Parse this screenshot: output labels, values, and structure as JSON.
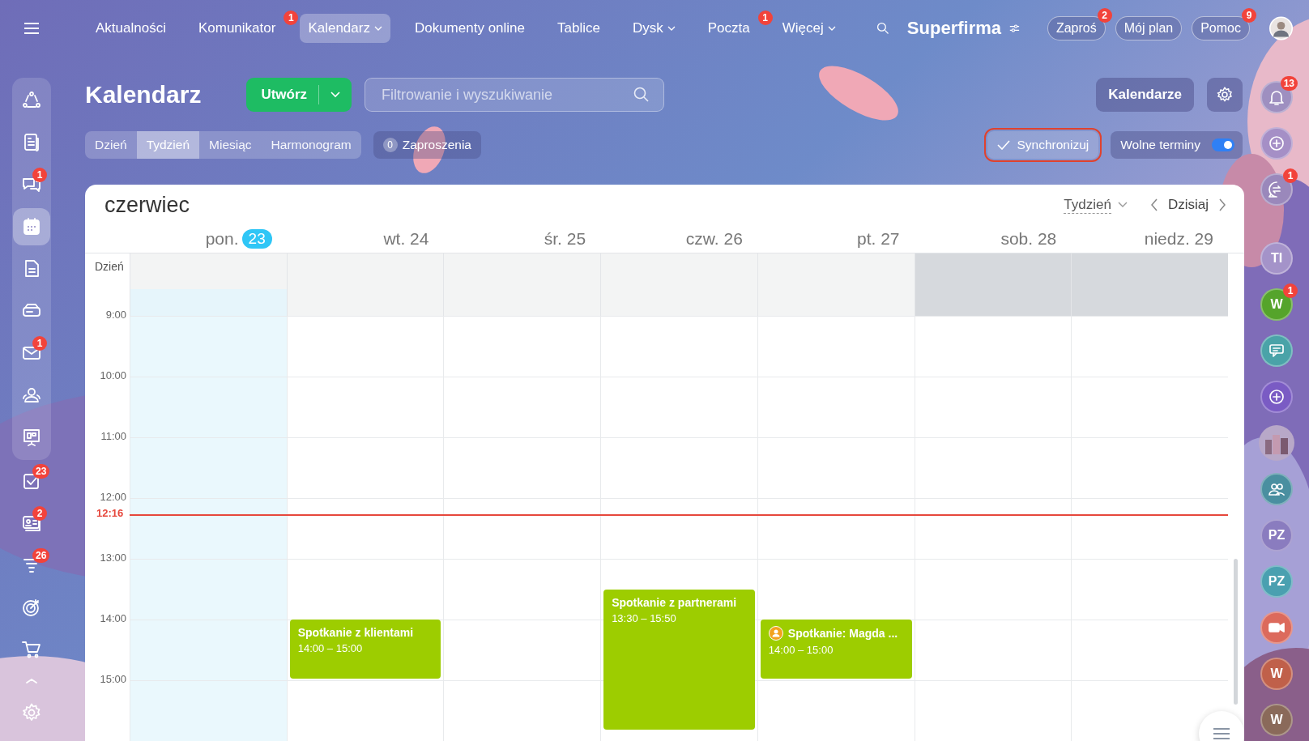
{
  "topbar": {
    "nav": [
      {
        "label": "Aktualności",
        "selected": false,
        "dropdown": false
      },
      {
        "label": "Komunikator",
        "selected": false,
        "dropdown": false,
        "badge": "1"
      },
      {
        "label": "Kalendarz",
        "selected": true,
        "dropdown": true
      },
      {
        "label": "Dokumenty online",
        "selected": false,
        "dropdown": false
      },
      {
        "label": "Tablice",
        "selected": false,
        "dropdown": false
      },
      {
        "label": "Dysk",
        "selected": false,
        "dropdown": true
      },
      {
        "label": "Poczta",
        "selected": false,
        "dropdown": false,
        "badge": "1"
      },
      {
        "label": "Więcej",
        "selected": false,
        "dropdown": true
      }
    ],
    "brand": "Superfirma",
    "buttons": [
      {
        "label": "Zaproś",
        "badge": "2"
      },
      {
        "label": "Mój plan"
      },
      {
        "label": "Pomoc",
        "badge": "9"
      }
    ]
  },
  "left_sidebar": {
    "items": [
      {
        "selected": false
      },
      {
        "selected": false
      },
      {
        "selected": false,
        "badge": "1"
      },
      {
        "selected": true
      },
      {
        "selected": false
      },
      {
        "selected": false
      },
      {
        "selected": false,
        "badge": "1"
      },
      {
        "selected": false
      },
      {
        "selected": false
      },
      {
        "selected": false,
        "badge": "23"
      },
      {
        "selected": false,
        "badge": "2"
      },
      {
        "selected": false,
        "badge": "26"
      },
      {
        "selected": false
      },
      {
        "selected": false
      },
      {
        "selected": false
      },
      {
        "selected": false
      }
    ]
  },
  "right_sidebar": {
    "items": [
      {
        "kind": "icon",
        "badge": "13",
        "color": "#9e8fc0"
      },
      {
        "kind": "icon",
        "color": "#a58fc6"
      },
      {
        "kind": "icon",
        "badge": "1",
        "color": "#9a88bb"
      },
      {
        "kind": "initials",
        "initials": "TI",
        "color": "#a493c9"
      },
      {
        "kind": "initials",
        "initials": "W",
        "badge": "1",
        "color": "#55a42b"
      },
      {
        "kind": "icon",
        "color": "#4aa3a8"
      },
      {
        "kind": "icon",
        "color": "#7a5bc4"
      },
      {
        "kind": "picture"
      },
      {
        "kind": "icon",
        "color": "#4a8fa0"
      },
      {
        "kind": "initials",
        "initials": "PZ",
        "color": "#8a7cbf"
      },
      {
        "kind": "initials",
        "initials": "PZ",
        "color": "#4aa0b0"
      },
      {
        "kind": "icon",
        "color": "#dc6a5c"
      },
      {
        "kind": "initials",
        "initials": "W",
        "color": "#c0604a"
      },
      {
        "kind": "initials",
        "initials": "W",
        "color": "#8a6a5a"
      }
    ]
  },
  "header": {
    "title": "Kalendarz",
    "create_button": "Utwórz",
    "search": {
      "placeholder": "Filtrowanie i wyszukiwanie"
    },
    "calendars_button": "Kalendarze",
    "views": [
      {
        "label": "Dzień",
        "selected": false
      },
      {
        "label": "Tydzień",
        "selected": true
      },
      {
        "label": "Miesiąc",
        "selected": false
      },
      {
        "label": "Harmonogram",
        "selected": false
      }
    ],
    "invitations": {
      "count": "0",
      "label": "Zaproszenia"
    },
    "sync_button": {
      "label": "Synchronizuj",
      "highlighted": true
    },
    "free_slots": {
      "label": "Wolne terminy",
      "on": true
    }
  },
  "calendar": {
    "month": "czerwiec",
    "view_select": "Tydzień",
    "today_button": "Dzisiaj",
    "all_day_label": "Dzień",
    "days": [
      {
        "name": "pon.",
        "number": "23",
        "today": true,
        "weekend": false
      },
      {
        "name": "wt.",
        "number": "24",
        "today": false,
        "weekend": false,
        "events": [
          {
            "kind": "meeting",
            "title": "Spotkanie z klientami",
            "time": "14:00 – 15:00"
          }
        ]
      },
      {
        "name": "śr.",
        "number": "25",
        "today": false,
        "weekend": false
      },
      {
        "name": "czw.",
        "number": "26",
        "today": false,
        "weekend": false,
        "events": [
          {
            "kind": "meeting",
            "title": "Spotkanie z partnerami",
            "time": "13:30 – 15:50"
          }
        ]
      },
      {
        "name": "pt.",
        "number": "27",
        "today": false,
        "weekend": false,
        "events": [
          {
            "kind": "invitation",
            "title": "Spotkanie: Magda ...",
            "time": "14:00 – 15:00"
          }
        ]
      },
      {
        "name": "sob.",
        "number": "28",
        "today": false,
        "weekend": true
      },
      {
        "name": "niedz.",
        "number": "29",
        "today": false,
        "weekend": true
      }
    ],
    "hours": [
      {
        "label": "9:00"
      },
      {
        "label": "10:00"
      },
      {
        "label": "11:00"
      },
      {
        "label": "12:00",
        "now": "12:16"
      },
      {
        "label": "13:00"
      },
      {
        "label": "14:00"
      },
      {
        "label": "15:00"
      }
    ]
  }
}
